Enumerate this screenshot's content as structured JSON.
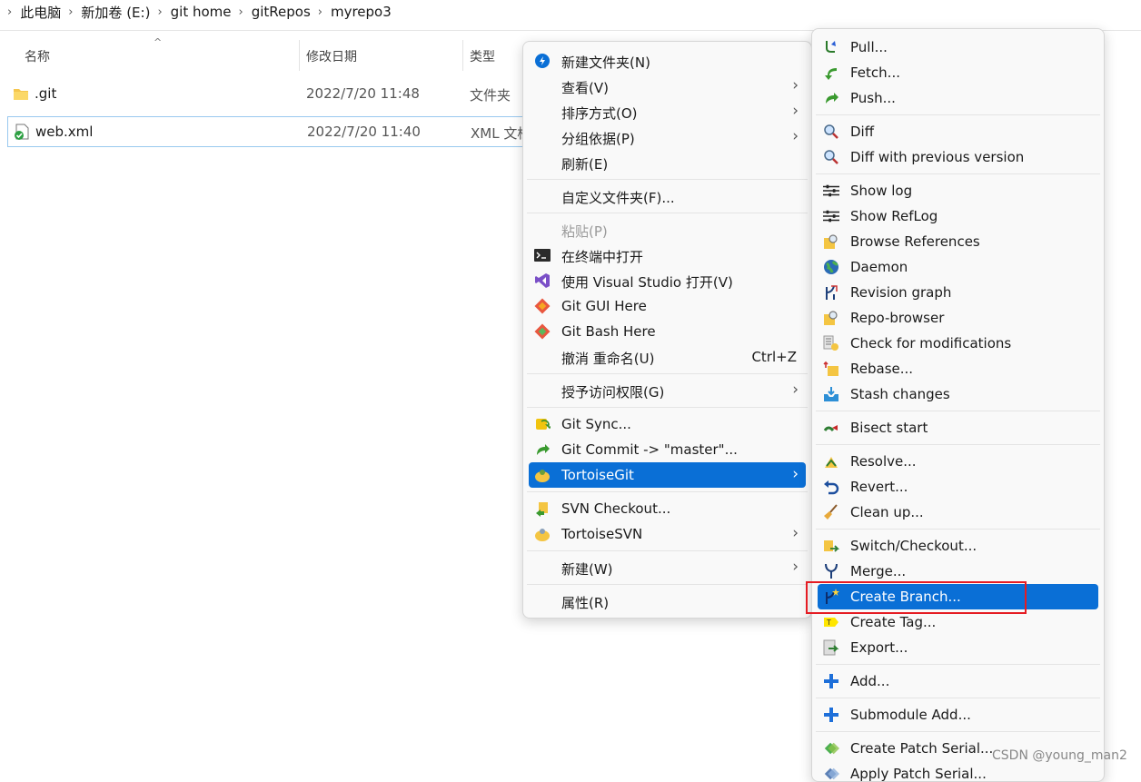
{
  "breadcrumb": [
    "此电脑",
    "新加卷 (E:)",
    "git home",
    "gitRepos",
    "myrepo3"
  ],
  "columns": {
    "name": "名称",
    "date": "修改日期",
    "type": "类型"
  },
  "files": [
    {
      "name": ".git",
      "date": "2022/7/20 11:48",
      "type": "文件夹"
    },
    {
      "name": "web.xml",
      "date": "2022/7/20 11:40",
      "type": "XML 文档"
    }
  ],
  "context_menu": {
    "new_folder": "新建文件夹(N)",
    "view": "查看(V)",
    "sort_by": "排序方式(O)",
    "group_by": "分组依据(P)",
    "refresh": "刷新(E)",
    "customize_folder": "自定义文件夹(F)...",
    "paste": "粘贴(P)",
    "open_terminal": "在终端中打开",
    "open_vs": "使用 Visual Studio 打开(V)",
    "git_gui": "Git GUI Here",
    "git_bash": "Git Bash Here",
    "undo_rename": "撤消 重命名(U)",
    "undo_shortcut": "Ctrl+Z",
    "give_access": "授予访问权限(G)",
    "git_sync": "Git Sync...",
    "git_commit": "Git Commit -> \"master\"...",
    "tortoisegit": "TortoiseGit",
    "svn_checkout": "SVN Checkout...",
    "tortoisesvn": "TortoiseSVN",
    "new": "新建(W)",
    "properties": "属性(R)"
  },
  "git_menu": {
    "pull": "Pull...",
    "fetch": "Fetch...",
    "push": "Push...",
    "diff": "Diff",
    "diff_prev": "Diff with previous version",
    "show_log": "Show log",
    "show_reflog": "Show RefLog",
    "browse_refs": "Browse References",
    "daemon": "Daemon",
    "revision_graph": "Revision graph",
    "repo_browser": "Repo-browser",
    "check_mods": "Check for modifications",
    "rebase": "Rebase...",
    "stash": "Stash changes",
    "bisect": "Bisect start",
    "resolve": "Resolve...",
    "revert": "Revert...",
    "cleanup": "Clean up...",
    "switch": "Switch/Checkout...",
    "merge": "Merge...",
    "create_branch": "Create Branch...",
    "create_tag": "Create Tag...",
    "export": "Export...",
    "add": "Add...",
    "submodule_add": "Submodule Add...",
    "create_patch": "Create Patch Serial...",
    "apply_patch": "Apply Patch Serial..."
  },
  "watermark": "CSDN @young_man2",
  "colors": {
    "highlight": "#0a6fd6",
    "annotation_box": "#e51c23"
  }
}
